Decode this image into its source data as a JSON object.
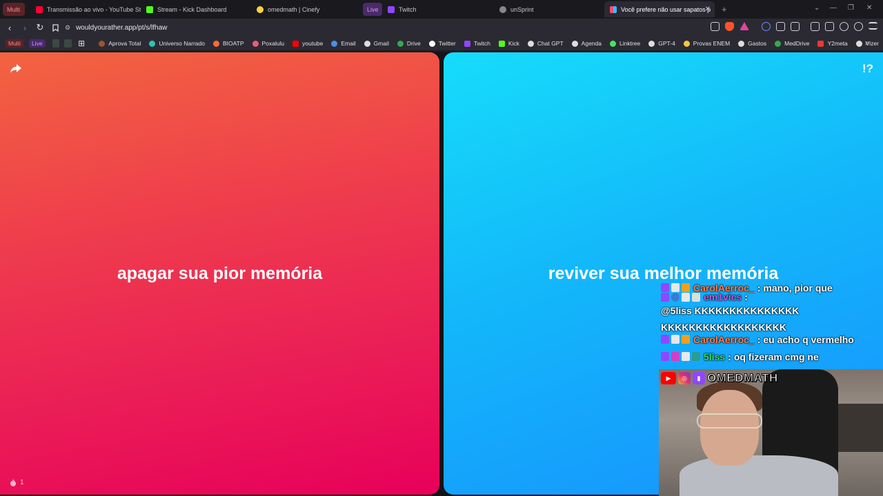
{
  "browser": {
    "groups": {
      "multi": {
        "label": "Multi",
        "color": "#5b2327",
        "text": "#f08b93"
      },
      "live": {
        "label": "Live",
        "color": "#4a2a6a",
        "text": "#c79cf5"
      }
    },
    "tabs": [
      {
        "title": "Transmissão ao vivo - YouTube Studio",
        "icon": "youtube-icon",
        "color": "#ff0033"
      },
      {
        "title": "Stream - Kick Dashboard",
        "icon": "kick-icon",
        "color": "#53fc18"
      },
      {
        "title": "omedmath | Cinefy",
        "icon": "cinefy-icon",
        "color": "#ffd23f"
      },
      {
        "title": "Twitch",
        "icon": "twitch-icon",
        "color": "#9146ff"
      },
      {
        "title": "unSprint",
        "icon": "globe-icon",
        "color": "#888888"
      },
      {
        "title": "Você prefere não usar sapatos p",
        "icon": "wyr-icon",
        "color": "#3db8ff"
      }
    ],
    "new_tab": "+",
    "url": "wouldyourather.app/pt/s/lfhaw",
    "bookmarks": [
      {
        "label": "Multi",
        "type": "group"
      },
      {
        "label": "Live",
        "type": "group"
      },
      {
        "label": "Aprova Total",
        "color": "#a0522d"
      },
      {
        "label": "Universo Narrado",
        "color": "#2ec4b6"
      },
      {
        "label": "BIOATP",
        "color": "#ff6b35"
      },
      {
        "label": "Poxalulu",
        "color": "#e85d75"
      },
      {
        "label": "youtube",
        "color": "#ff0000"
      },
      {
        "label": "Email",
        "color": "#4a90e2"
      },
      {
        "label": "Gmail",
        "color": "#dddddd"
      },
      {
        "label": "Drive",
        "color": "#34a853"
      },
      {
        "label": "Twitter",
        "color": "#ffffff"
      },
      {
        "label": "Twitch",
        "color": "#9146ff"
      },
      {
        "label": "Kick",
        "color": "#53fc18"
      },
      {
        "label": "Chat GPT",
        "color": "#dddddd"
      },
      {
        "label": "Agenda",
        "color": "#dddddd"
      },
      {
        "label": "Linktree",
        "color": "#43e660"
      },
      {
        "label": "GPT-4",
        "color": "#dddddd"
      },
      {
        "label": "Provas ENEM",
        "color": "#f5c542"
      },
      {
        "label": "Gastos",
        "color": "#dddddd"
      },
      {
        "label": "MedDrive",
        "color": "#34a853"
      },
      {
        "label": "Y2meta",
        "color": "#e53935"
      },
      {
        "label": "Vizer",
        "color": "#dddddd"
      }
    ]
  },
  "game": {
    "option_left": "apagar sua pior memória",
    "option_right": "reviver sua melhor memória",
    "votes": "1",
    "help": "!?"
  },
  "chat": [
    {
      "user": "CarolAerroc_",
      "user_color": "#ff7f50",
      "sep": ":",
      "message": "mano, pior que"
    },
    {
      "user": "em1vics",
      "user_color": "#c356e6",
      "sep": ":",
      "message": "@5liss KKKKKKKKKKKKKKKKKKKKKKKKKKKKKKKKK"
    },
    {
      "user": "CarolAerroc_",
      "user_color": "#ff7f50",
      "sep": ":",
      "message": "eu acho q vermelho"
    },
    {
      "user": "5liss",
      "user_color": "#2ee36b",
      "sep": ":",
      "message": "oq fizeram cmg ne"
    }
  ],
  "stream": {
    "brand": "OMEDMATH"
  }
}
